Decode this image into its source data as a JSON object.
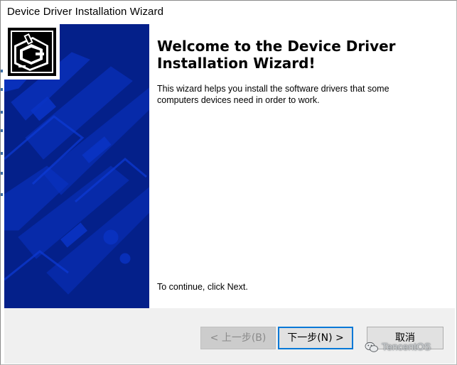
{
  "window": {
    "title": "Device Driver Installation Wizard"
  },
  "content": {
    "heading": "Welcome to the Device Driver Installation Wizard!",
    "description": "This wizard helps you install the software drivers that some computers devices need in order to work.",
    "continue_text": "To continue, click Next."
  },
  "buttons": {
    "back_label": "< 上一步(B)",
    "next_label": "下一步(N) >",
    "cancel_label": "取消"
  },
  "watermark": {
    "text": "TencentOS"
  },
  "colors": {
    "banner_bg": "#04208a",
    "banner_shape": "#0a33c4",
    "accent_focus": "#0078d7"
  },
  "icons": {
    "hero": "hardware-install-icon",
    "watermark": "wechat-icon"
  }
}
